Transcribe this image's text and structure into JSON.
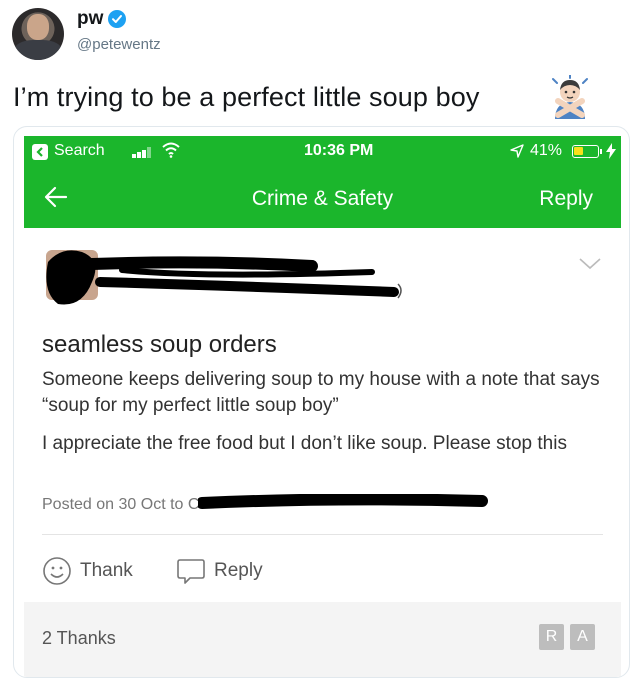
{
  "tweet": {
    "display_name": "pw",
    "handle": "@petewentz",
    "text": "I’m trying to be a perfect little soup boy"
  },
  "status_bar": {
    "back_app": "Search",
    "time": "10:36 PM",
    "battery": "41%",
    "battery_level": 0.41,
    "accent_color": "#1bb62c"
  },
  "nav": {
    "title": "Crime & Safety",
    "reply": "Reply"
  },
  "post": {
    "title": "seamless soup orders",
    "body": [
      "Someone keeps delivering soup to my house with a note that says “soup for my perfect little soup boy”",
      "I appreciate the free food but I don’t like soup. Please stop this"
    ],
    "posted_prefix": "Posted on 30 Oct to C"
  },
  "actions": {
    "thank": "Thank",
    "reply": "Reply"
  },
  "footer": {
    "thanks_count": "2 Thanks",
    "initials": [
      "R",
      "A"
    ]
  },
  "icons": [
    "verified-badge-icon",
    "back-chevron-icon",
    "signal-bars-icon",
    "wifi-icon",
    "location-arrow-icon",
    "battery-icon",
    "charging-bolt-icon",
    "back-arrow-icon",
    "chevron-down-icon",
    "smiley-icon",
    "speech-bubble-icon",
    "person-gesturing-no-emoji"
  ]
}
